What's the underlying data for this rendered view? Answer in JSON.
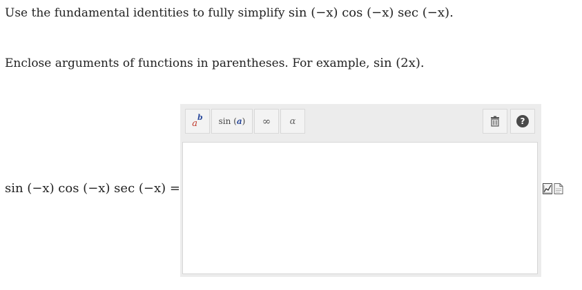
{
  "question": {
    "instruction_text": "Use the fundamental identities to fully simplify",
    "instruction_expr": "sin (−x) cos (−x) sec (−x).",
    "hint_text": "Enclose arguments of functions in parentheses. For example,",
    "hint_expr": "sin (2x)."
  },
  "equation": {
    "lhs": "sin (−x) cos (−x) sec (−x) ="
  },
  "toolbar": {
    "power_base": "a",
    "power_exp": "b",
    "sin_func": "sin",
    "sin_arg": "a",
    "infinity": "∞",
    "alpha": "α",
    "help": "?"
  },
  "answer": {
    "value": ""
  },
  "icons": [
    "power-icon",
    "sin-icon",
    "infinity-icon",
    "alpha-icon",
    "trash-icon",
    "help-icon",
    "graph-icon",
    "document-icon"
  ]
}
